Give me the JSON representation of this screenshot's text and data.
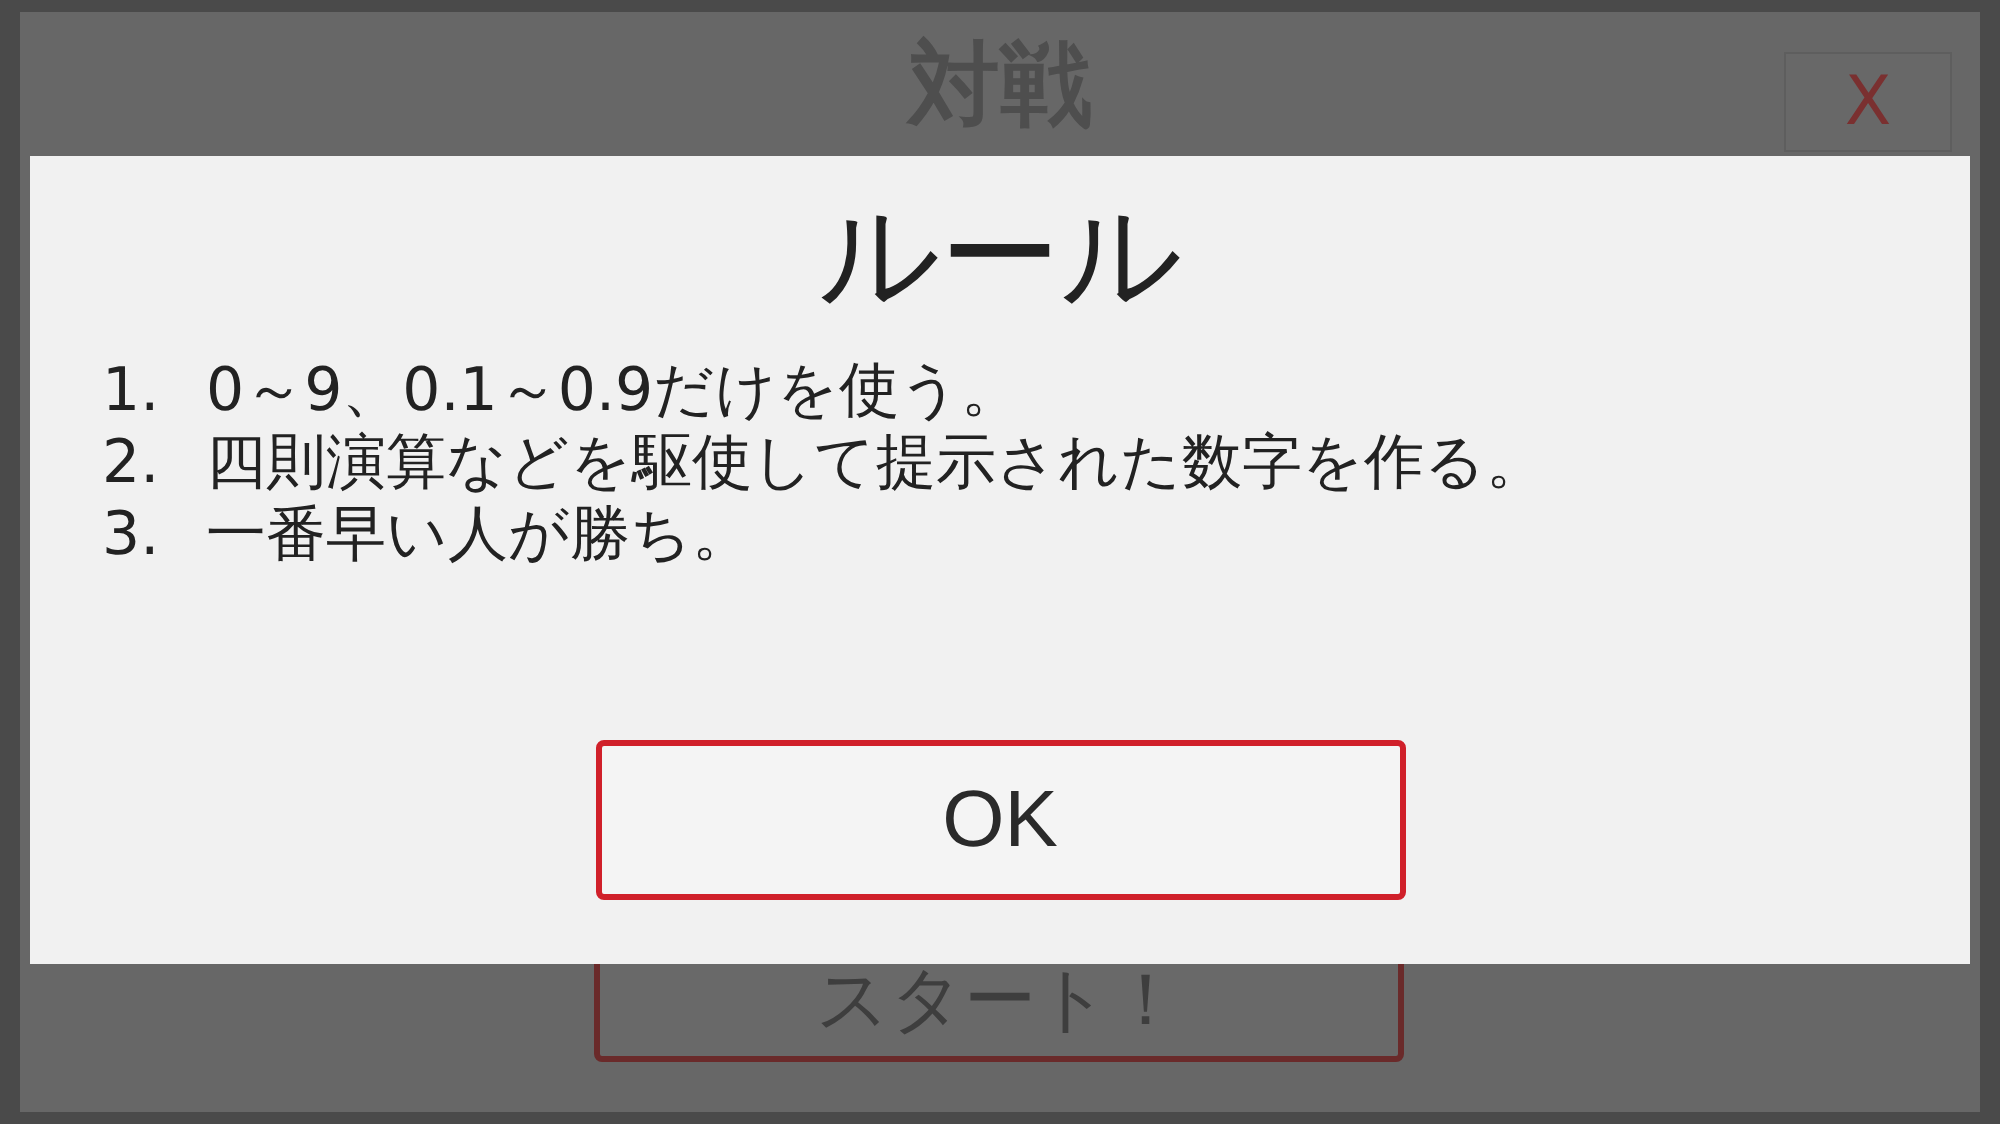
{
  "screen": {
    "title": "対戦",
    "close_label": "X",
    "start_label": "スタート！"
  },
  "dialog": {
    "title": "ルール",
    "rules": [
      {
        "number": "1.",
        "text": "0～9、0.1～0.9だけを使う。"
      },
      {
        "number": "2.",
        "text": "四則演算などを駆使して提示された数字を作る。"
      },
      {
        "number": "3.",
        "text": "一番早い人が勝ち。"
      }
    ],
    "ok_label": "OK"
  }
}
